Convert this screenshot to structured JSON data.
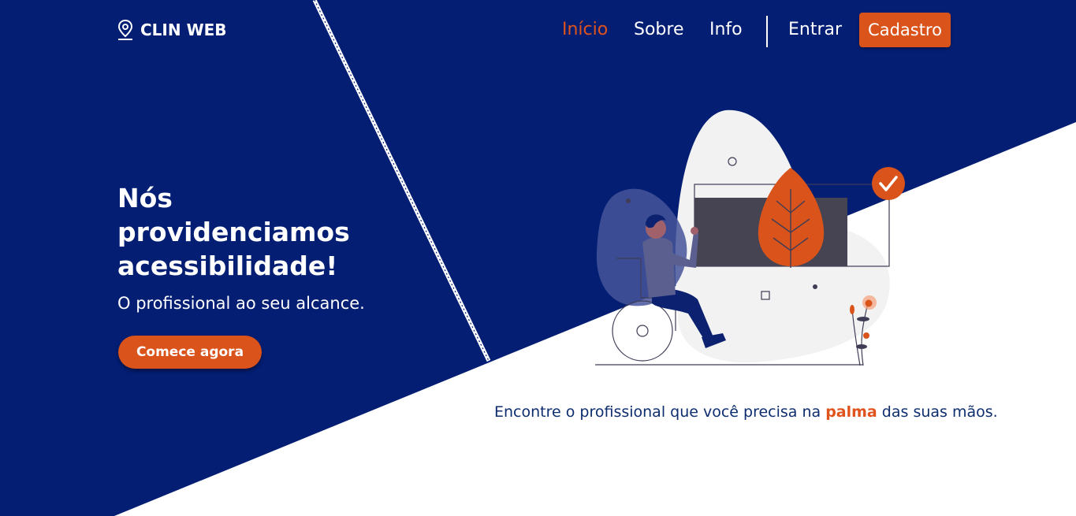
{
  "brand": {
    "name": "CLIN WEB",
    "icon": "map-pin-icon"
  },
  "nav": {
    "items": [
      {
        "label": "Início",
        "active": true
      },
      {
        "label": "Sobre",
        "active": false
      },
      {
        "label": "Info",
        "active": false
      }
    ],
    "login_label": "Entrar",
    "signup_label": "Cadastro"
  },
  "hero": {
    "title": "Nós providenciamos acessibilidade!",
    "subtitle": "O profissional ao seu alcance.",
    "cta_label": "Comece agora"
  },
  "tagline": {
    "before": "Encontre o profissional que você precisa na ",
    "highlight": "palma",
    "after": " das suas mãos."
  },
  "colors": {
    "navy": "#031e73",
    "accent": "#d9531a",
    "white": "#ffffff",
    "illustration_gray": "#f2f2f2",
    "screen_dark": "#464452"
  }
}
